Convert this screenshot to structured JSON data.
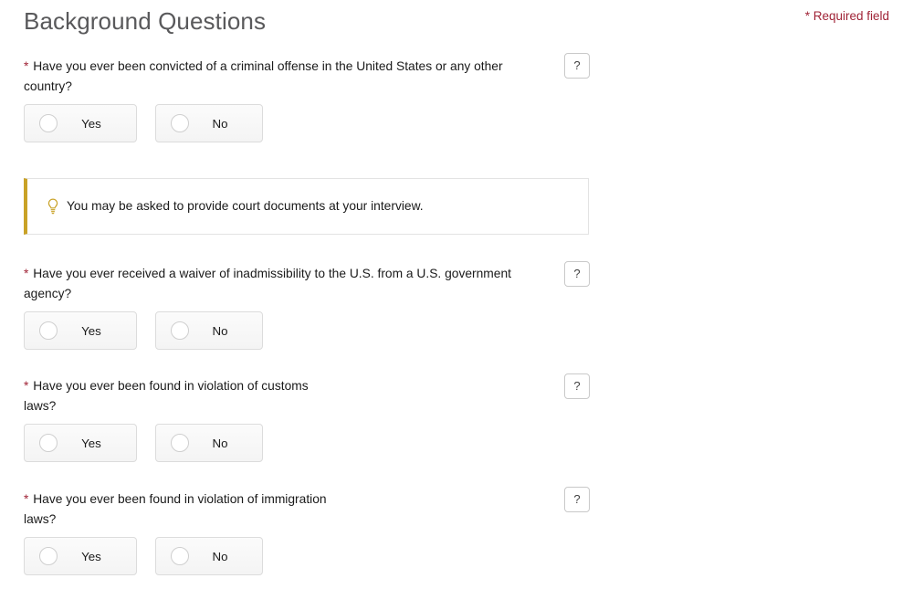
{
  "header": {
    "title": "Background Questions",
    "required_note": "* Required field",
    "required_color": "#a02437"
  },
  "labels": {
    "required_star": "*",
    "help_label": "?"
  },
  "options": {
    "yes": "Yes",
    "no": "No"
  },
  "questions": [
    {
      "text_line1": "Have you ever been convicted of a criminal offense in the United States or any other",
      "text_line2": "country?"
    },
    {
      "text_line1": "Have you ever received a waiver of inadmissibility to the U.S. from a U.S. government",
      "text_line2": "agency?"
    },
    {
      "text_line1": "Have you ever been found in violation of customs",
      "text_line2": "laws?"
    },
    {
      "text_line1": "Have you ever been found in violation of immigration",
      "text_line2": "laws?"
    }
  ],
  "callout": {
    "text": "You may be asked to provide court documents at your interview.",
    "icon": "lightbulb-icon",
    "accent_color": "#c9a227"
  }
}
